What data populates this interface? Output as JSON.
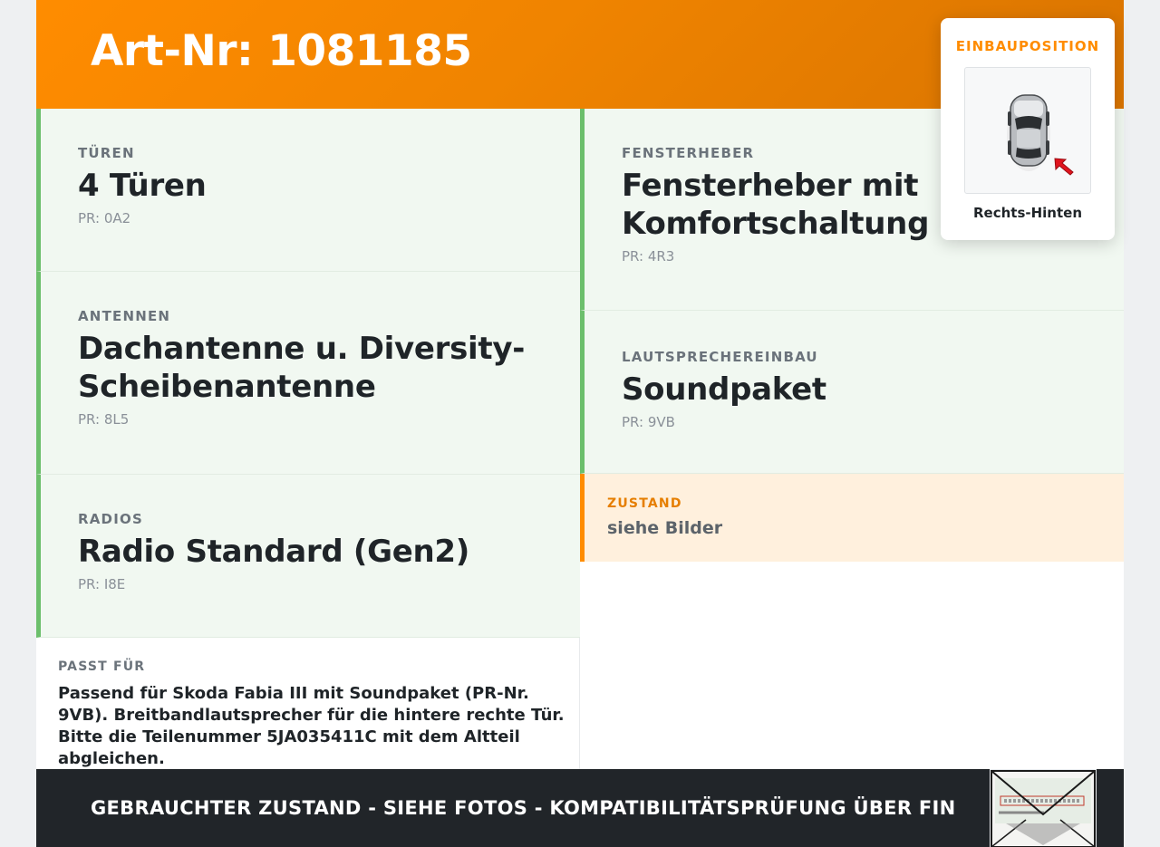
{
  "header": {
    "title": "Art-Nr: 1081185"
  },
  "left_specs": [
    {
      "label": "TÜREN",
      "value": "4 Türen",
      "pr": "PR: 0A2"
    },
    {
      "label": "ANTENNEN",
      "value": "Dachantenne u. Diversity-Scheibenantenne",
      "pr": "PR: 8L5"
    },
    {
      "label": "RADIOS",
      "value": "Radio Standard (Gen2)",
      "pr": "PR: I8E"
    }
  ],
  "right_specs": [
    {
      "label": "FENSTERHEBER",
      "value": "Fensterheber mit Komfortschaltung elektr.",
      "pr": "PR: 4R3"
    },
    {
      "label": "LAUTSPRECHEREINBAU",
      "value": "Soundpaket",
      "pr": "PR: 9VB"
    }
  ],
  "zustand": {
    "label": "ZUSTAND",
    "value": "siehe Bilder"
  },
  "passt": {
    "label": "PASST FÜR",
    "text": "Passend für Skoda Fabia III mit Soundpaket (PR-Nr. 9VB). Breitbandlautsprecher für die hintere rechte Tür. Bitte die Teilenummer 5JA035411C mit dem Altteil abgleichen."
  },
  "popup": {
    "title": "EINBAUPOSITION",
    "caption": "Rechts-Hinten",
    "icon": "car-top-view-icon"
  },
  "footer": {
    "text": "GEBRAUCHTER ZUSTAND - SIEHE FOTOS - KOMPATIBILITÄTSPRÜFUNG ÜBER FIN"
  },
  "colors": {
    "accent": "#ff8c00",
    "spec_border": "#6cbf6c",
    "spec_bg": "#f1f8f1",
    "zustand_bg": "#fff0dd",
    "footer_bg": "#212529"
  }
}
